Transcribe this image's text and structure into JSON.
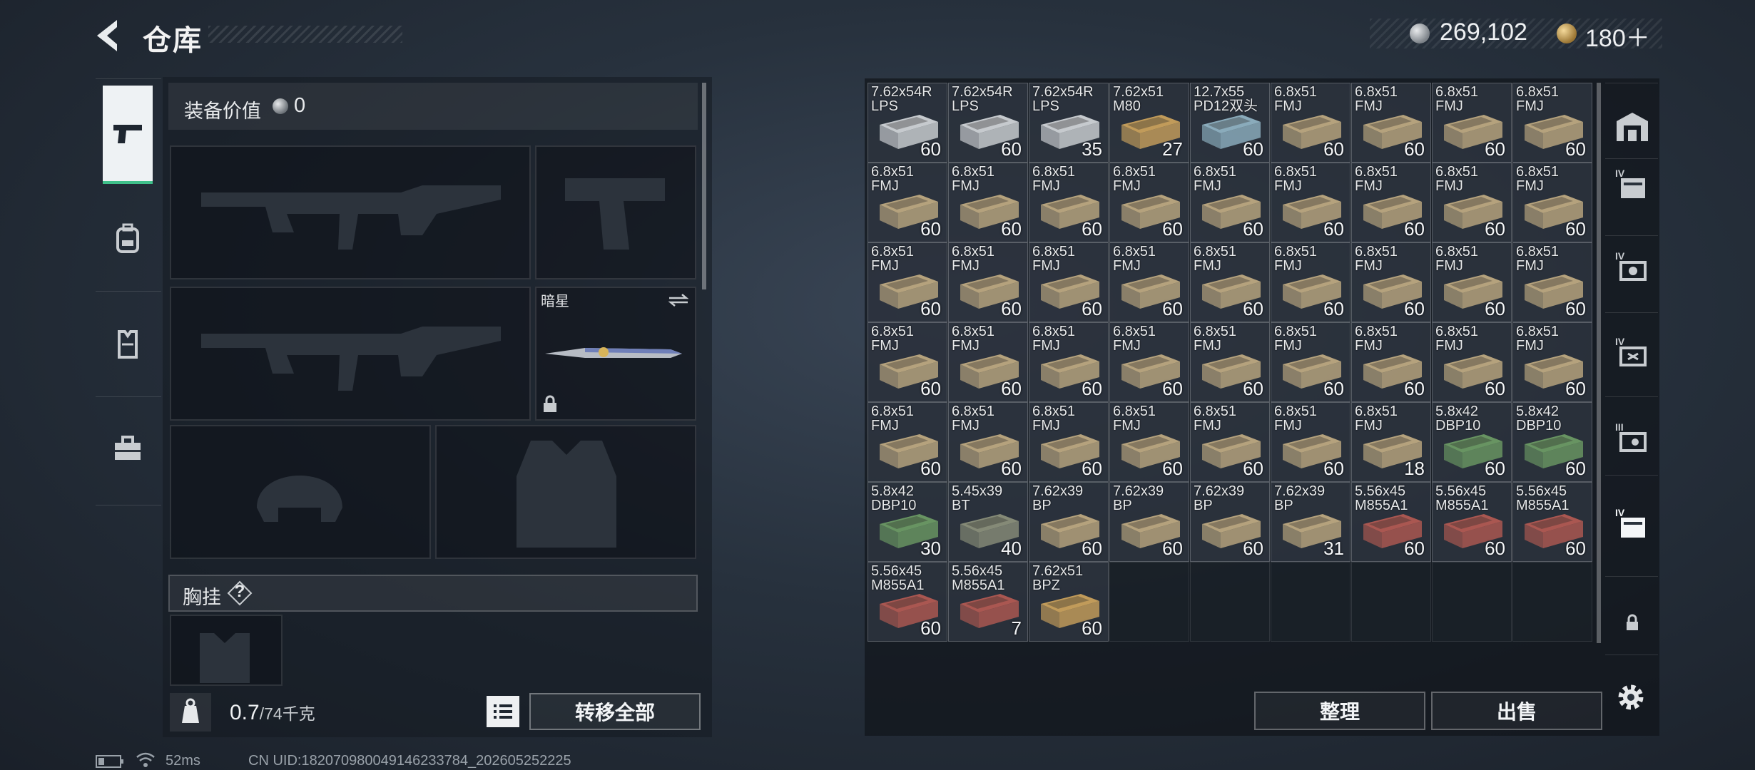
{
  "header": {
    "title": "仓库",
    "silver_amount": "269,102",
    "gold_amount": "180＋"
  },
  "equipment": {
    "value_label": "装备价值",
    "value": "0",
    "knife_name": "暗星",
    "vest_label": "胸挂",
    "help": "?"
  },
  "footer_left": {
    "weight_current": "0.7",
    "weight_capacity": "/74千克",
    "transfer_all": "转移全部"
  },
  "footer_right": {
    "organize": "整理",
    "sell": "出售"
  },
  "status": {
    "ping": "52ms",
    "uid": "CN UID:18207098004914623378​4_202605252225"
  },
  "storage_items": [
    {
      "label": "7.62x54R\nLPS",
      "count": "60",
      "color": "#cfd3d6"
    },
    {
      "label": "7.62x54R\nLPS",
      "count": "60",
      "color": "#cfd3d6"
    },
    {
      "label": "7.62x54R\nLPS",
      "count": "35",
      "color": "#cfd3d6"
    },
    {
      "label": "7.62x51\nM80",
      "count": "27",
      "color": "#c9a15c"
    },
    {
      "label": "12.7x55\nPD12双头",
      "count": "60",
      "color": "#8fb2c2"
    },
    {
      "label": "6.8x51\nFMJ",
      "count": "60",
      "color": "#bda981"
    },
    {
      "label": "6.8x51\nFMJ",
      "count": "60",
      "color": "#bda981"
    },
    {
      "label": "6.8x51\nFMJ",
      "count": "60",
      "color": "#bda981"
    },
    {
      "label": "6.8x51\nFMJ",
      "count": "60",
      "color": "#bda981"
    },
    {
      "label": "6.8x51\nFMJ",
      "count": "60",
      "color": "#bda981"
    },
    {
      "label": "6.8x51\nFMJ",
      "count": "60",
      "color": "#bda981"
    },
    {
      "label": "6.8x51\nFMJ",
      "count": "60",
      "color": "#bda981"
    },
    {
      "label": "6.8x51\nFMJ",
      "count": "60",
      "color": "#bda981"
    },
    {
      "label": "6.8x51\nFMJ",
      "count": "60",
      "color": "#bda981"
    },
    {
      "label": "6.8x51\nFMJ",
      "count": "60",
      "color": "#bda981"
    },
    {
      "label": "6.8x51\nFMJ",
      "count": "60",
      "color": "#bda981"
    },
    {
      "label": "6.8x51\nFMJ",
      "count": "60",
      "color": "#bda981"
    },
    {
      "label": "6.8x51\nFMJ",
      "count": "60",
      "color": "#bda981"
    },
    {
      "label": "6.8x51\nFMJ",
      "count": "60",
      "color": "#bda981"
    },
    {
      "label": "6.8x51\nFMJ",
      "count": "60",
      "color": "#bda981"
    },
    {
      "label": "6.8x51\nFMJ",
      "count": "60",
      "color": "#bda981"
    },
    {
      "label": "6.8x51\nFMJ",
      "count": "60",
      "color": "#bda981"
    },
    {
      "label": "6.8x51\nFMJ",
      "count": "60",
      "color": "#bda981"
    },
    {
      "label": "6.8x51\nFMJ",
      "count": "60",
      "color": "#bda981"
    },
    {
      "label": "6.8x51\nFMJ",
      "count": "60",
      "color": "#bda981"
    },
    {
      "label": "6.8x51\nFMJ",
      "count": "60",
      "color": "#bda981"
    },
    {
      "label": "6.8x51\nFMJ",
      "count": "60",
      "color": "#bda981"
    },
    {
      "label": "6.8x51\nFMJ",
      "count": "60",
      "color": "#bda981"
    },
    {
      "label": "6.8x51\nFMJ",
      "count": "60",
      "color": "#bda981"
    },
    {
      "label": "6.8x51\nFMJ",
      "count": "60",
      "color": "#bda981"
    },
    {
      "label": "6.8x51\nFMJ",
      "count": "60",
      "color": "#bda981"
    },
    {
      "label": "6.8x51\nFMJ",
      "count": "60",
      "color": "#bda981"
    },
    {
      "label": "6.8x51\nFMJ",
      "count": "60",
      "color": "#bda981"
    },
    {
      "label": "6.8x51\nFMJ",
      "count": "60",
      "color": "#bda981"
    },
    {
      "label": "6.8x51\nFMJ",
      "count": "60",
      "color": "#bda981"
    },
    {
      "label": "6.8x51\nFMJ",
      "count": "60",
      "color": "#bda981"
    },
    {
      "label": "6.8x51\nFMJ",
      "count": "60",
      "color": "#bda981"
    },
    {
      "label": "6.8x51\nFMJ",
      "count": "60",
      "color": "#bda981"
    },
    {
      "label": "6.8x51\nFMJ",
      "count": "60",
      "color": "#bda981"
    },
    {
      "label": "6.8x51\nFMJ",
      "count": "60",
      "color": "#bda981"
    },
    {
      "label": "6.8x51\nFMJ",
      "count": "60",
      "color": "#bda981"
    },
    {
      "label": "6.8x51\nFMJ",
      "count": "60",
      "color": "#bda981"
    },
    {
      "label": "6.8x51\nFMJ",
      "count": "18",
      "color": "#bda981"
    },
    {
      "label": "5.8x42\nDBP10",
      "count": "60",
      "color": "#6b9a64"
    },
    {
      "label": "5.8x42\nDBP10",
      "count": "60",
      "color": "#6b9a64"
    },
    {
      "label": "5.8x42\nDBP10",
      "count": "30",
      "color": "#6b9a64"
    },
    {
      "label": "5.45x39\nBT",
      "count": "40",
      "color": "#8a8f7a"
    },
    {
      "label": "7.62x39\nBP",
      "count": "60",
      "color": "#bda981"
    },
    {
      "label": "7.62x39\nBP",
      "count": "60",
      "color": "#bda981"
    },
    {
      "label": "7.62x39\nBP",
      "count": "60",
      "color": "#bda981"
    },
    {
      "label": "7.62x39\nBP",
      "count": "31",
      "color": "#bda981"
    },
    {
      "label": "5.56x45\nM855A1",
      "count": "60",
      "color": "#b15a52"
    },
    {
      "label": "5.56x45\nM855A1",
      "count": "60",
      "color": "#b15a52"
    },
    {
      "label": "5.56x45\nM855A1",
      "count": "60",
      "color": "#b15a52"
    },
    {
      "label": "5.56x45\nM855A1",
      "count": "60",
      "color": "#b15a52"
    },
    {
      "label": "5.56x45\nM855A1",
      "count": "7",
      "color": "#b15a52"
    },
    {
      "label": "7.62x51\nBPZ",
      "count": "60",
      "color": "#c9a15c"
    }
  ],
  "grid": {
    "columns": 9,
    "rows": 7
  }
}
